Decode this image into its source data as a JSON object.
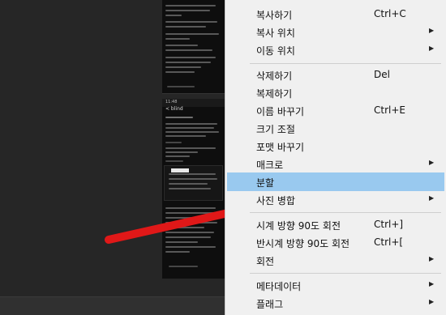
{
  "menu": {
    "items": [
      {
        "label": "복사하기",
        "shortcut": "Ctrl+C",
        "submenu": false
      },
      {
        "label": "복사 위치",
        "shortcut": "",
        "submenu": true
      },
      {
        "label": "이동 위치",
        "shortcut": "",
        "submenu": true
      },
      {
        "label": "삭제하기",
        "shortcut": "Del",
        "submenu": false
      },
      {
        "label": "복제하기",
        "shortcut": "",
        "submenu": false
      },
      {
        "label": "이름 바꾸기",
        "shortcut": "Ctrl+E",
        "submenu": false
      },
      {
        "label": "크기 조절",
        "shortcut": "",
        "submenu": false
      },
      {
        "label": "포맷 바꾸기",
        "shortcut": "",
        "submenu": false
      },
      {
        "label": "매크로",
        "shortcut": "",
        "submenu": true
      },
      {
        "label": "분할",
        "shortcut": "",
        "submenu": false,
        "highlighted": true
      },
      {
        "label": "사진 병합",
        "shortcut": "",
        "submenu": true
      },
      {
        "label": "시계 방향 90도 회전",
        "shortcut": "Ctrl+]",
        "submenu": false
      },
      {
        "label": "반시계 방향 90도 회전",
        "shortcut": "Ctrl+[",
        "submenu": false
      },
      {
        "label": "회전",
        "shortcut": "",
        "submenu": true
      },
      {
        "label": "메타데이터",
        "shortcut": "",
        "submenu": true
      },
      {
        "label": "플래그",
        "shortcut": "",
        "submenu": true
      }
    ],
    "submenu_glyph": "▶"
  },
  "phone_bottom": {
    "time": "11:48",
    "back_label": "< blind"
  },
  "colors": {
    "highlight": "#99c9ef",
    "arrow": "#e01818",
    "menu_bg": "#f0f0f0"
  }
}
